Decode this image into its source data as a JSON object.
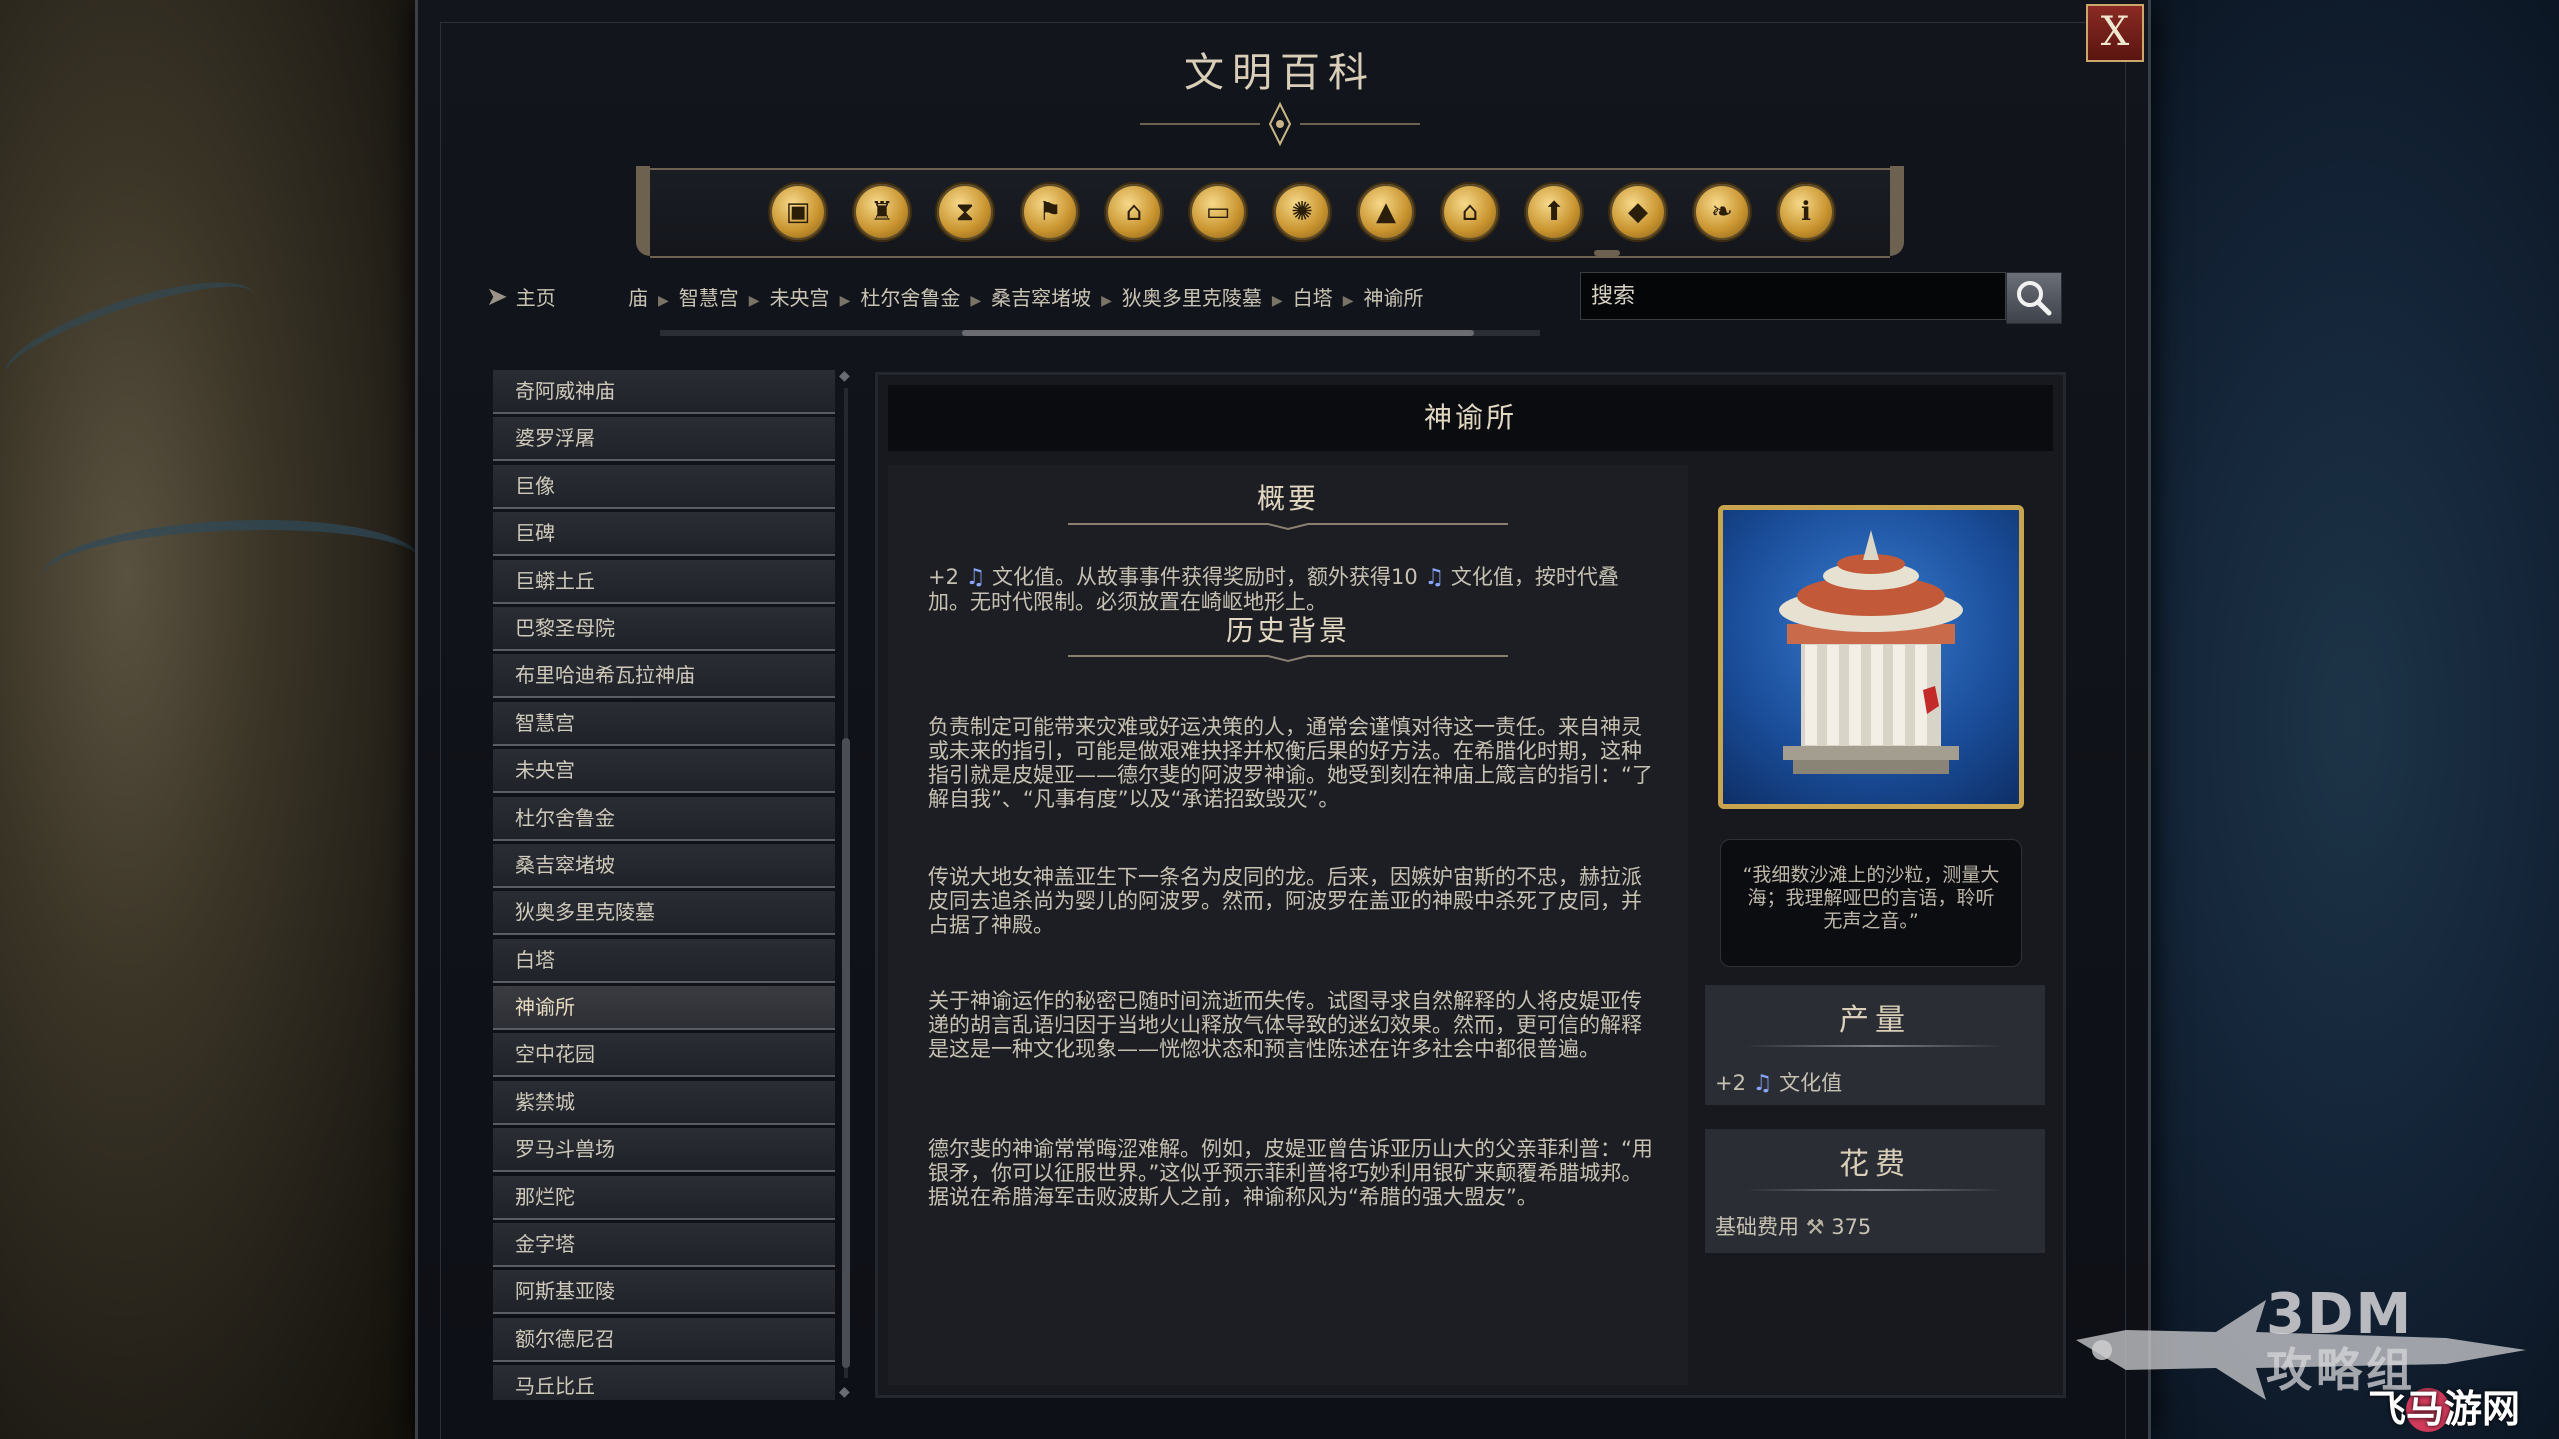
{
  "window": {
    "title": "文明百科",
    "close_label": "X"
  },
  "categories": [
    {
      "icon": "boxes-icon",
      "glyph": "▣"
    },
    {
      "icon": "goblet-icon",
      "glyph": "♜"
    },
    {
      "icon": "hourglass-icon",
      "glyph": "⧗"
    },
    {
      "icon": "flag-icon",
      "glyph": "⚑"
    },
    {
      "icon": "building-icon",
      "glyph": "⌂"
    },
    {
      "icon": "book-icon",
      "glyph": "▭"
    },
    {
      "icon": "atom-icon",
      "glyph": "✺"
    },
    {
      "icon": "mountain-icon",
      "glyph": "▲"
    },
    {
      "icon": "house-icon",
      "glyph": "⌂"
    },
    {
      "icon": "arrow-up-icon",
      "glyph": "⬆"
    },
    {
      "icon": "gem-icon",
      "glyph": "◆"
    },
    {
      "icon": "dove-icon",
      "glyph": "❧"
    },
    {
      "icon": "info-icon",
      "glyph": "ℹ"
    }
  ],
  "nav": {
    "home_label": "主页",
    "breadcrumbs": [
      "庙",
      "智慧宫",
      "未央宫",
      "杜尔舍鲁金",
      "桑吉窣堵坡",
      "狄奥多里克陵墓",
      "白塔",
      "神谕所"
    ]
  },
  "search": {
    "placeholder": "搜索"
  },
  "list": {
    "items": [
      "奇阿威神庙",
      "婆罗浮屠",
      "巨像",
      "巨碑",
      "巨蟒土丘",
      "巴黎圣母院",
      "布里哈迪希瓦拉神庙",
      "智慧宫",
      "未央宫",
      "杜尔舍鲁金",
      "桑吉窣堵坡",
      "狄奥多里克陵墓",
      "白塔",
      "神谕所",
      "空中花园",
      "紫禁城",
      "罗马斗兽场",
      "那烂陀",
      "金字塔",
      "阿斯基亚陵",
      "额尔德尼召",
      "马丘比丘"
    ],
    "active_index": 13
  },
  "detail": {
    "title": "神谕所",
    "summary_head": "概要",
    "summary_pre": "+2 ",
    "summary_mid": " 文化值。从故事事件获得奖励时，额外获得10 ",
    "summary_post": " 文化值，按时代叠加。无时代限制。必须放置在崎岖地形上。",
    "history_head": "历史背景",
    "paragraphs": [
      "负责制定可能带来灾难或好运决策的人，通常会谨慎对待这一责任。来自神灵或未来的指引，可能是做艰难抉择并权衡后果的好方法。在希腊化时期，这种指引就是皮媞亚——德尔斐的阿波罗神谕。她受到刻在神庙上箴言的指引：“了解自我”、“凡事有度”以及“承诺招致毁灭”。",
      "传说大地女神盖亚生下一条名为皮同的龙。后来，因嫉妒宙斯的不忠，赫拉派皮同去追杀尚为婴儿的阿波罗。然而，阿波罗在盖亚的神殿中杀死了皮同，并占据了神殿。",
      "关于神谕运作的秘密已随时间流逝而失传。试图寻求自然解释的人将皮媞亚传递的胡言乱语归因于当地火山释放气体导致的迷幻效果。然而，更可信的解释是这是一种文化现象——恍惚状态和预言性陈述在许多社会中都很普遍。",
      "德尔斐的神谕常常晦涩难解。例如，皮媞亚曾告诉亚历山大的父亲菲利普：“用银矛，你可以征服世界。”这似乎预示菲利普将巧妙利用银矿来颠覆希腊城邦。据说在希腊海军击败波斯人之前，神谕称风为“希腊的强大盟友”。"
    ],
    "quote": "“我细数沙滩上的沙粒，测量大海；我理解哑巴的言语，聆听无声之音。”",
    "yield": {
      "head": "产量",
      "amount": "+2",
      "icon": "culture-note-icon",
      "label": "文化值"
    },
    "cost": {
      "head": "花费",
      "label": "基础费用",
      "icon": "hammer-icon",
      "value": "375"
    }
  },
  "watermark": {
    "line1": "3DM",
    "line2": "攻略组",
    "line3": "飞马游网"
  },
  "colors": {
    "accent_gold": "#c8a44e",
    "culture_blue": "#8aa6ff",
    "close_red": "#8a2a24"
  }
}
